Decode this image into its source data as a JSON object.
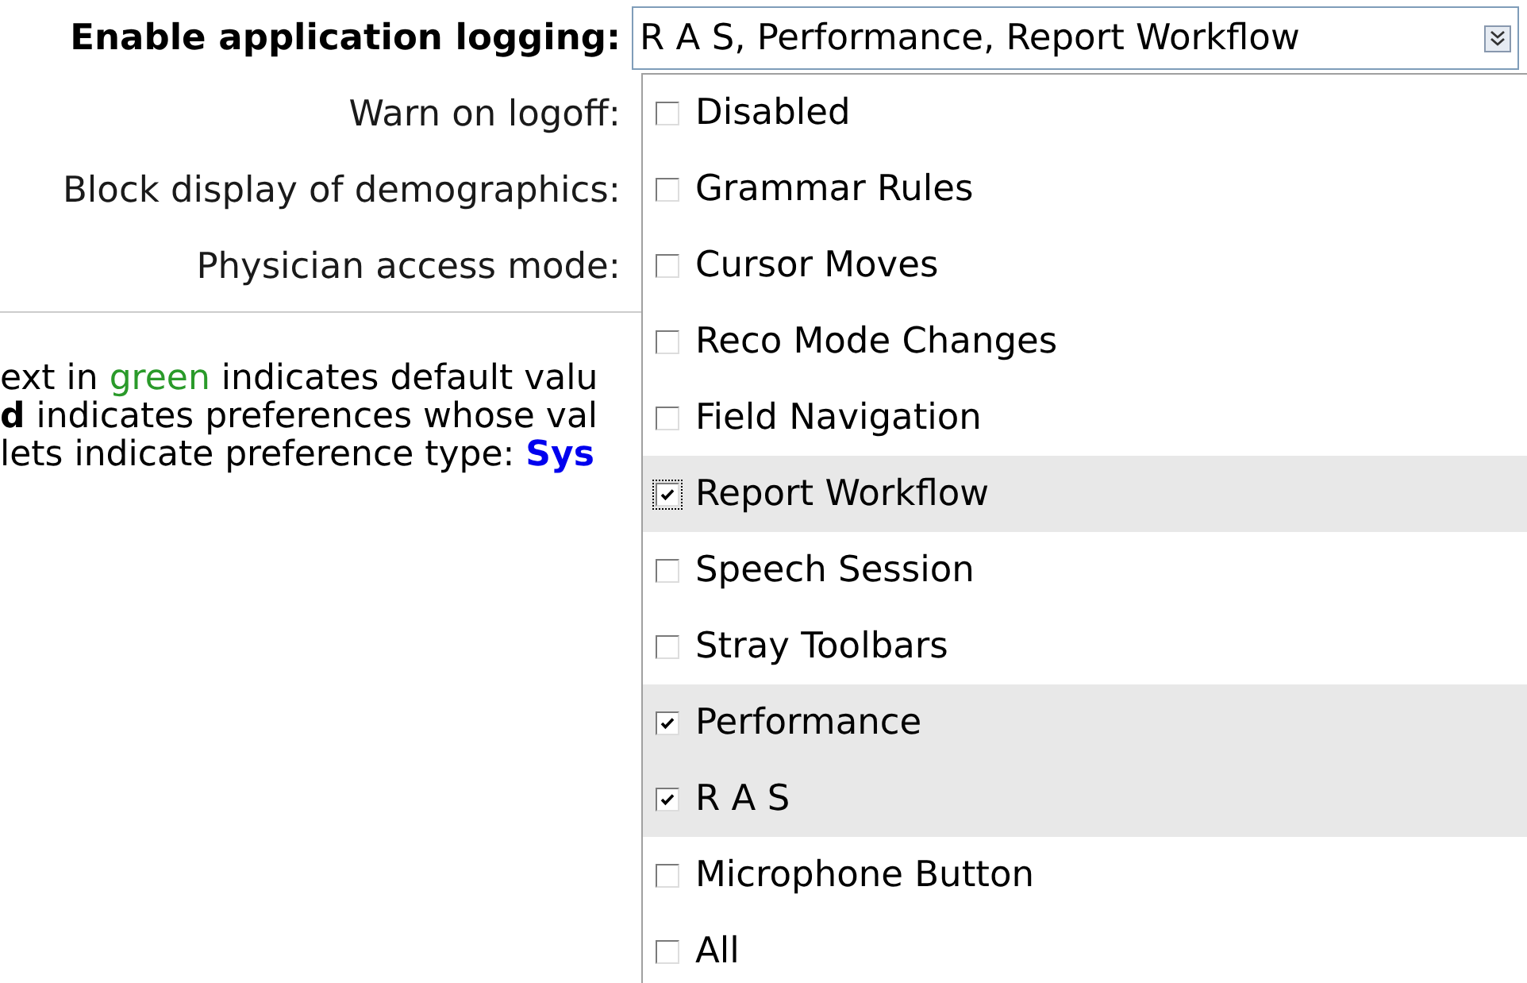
{
  "preferences": [
    {
      "label": "Enable application logging:",
      "kind": "multiselect",
      "value": "R A S, Performance, Report Workflow",
      "expanded": true
    },
    {
      "label": "Warn on logoff:",
      "kind": "plain"
    },
    {
      "label": "Block display of demographics:",
      "kind": "plain"
    },
    {
      "label": "Physician access mode:",
      "kind": "plain"
    }
  ],
  "notes": [
    [
      {
        "text": "ext in ",
        "kind": "plain"
      },
      {
        "text": "green",
        "kind": "green"
      },
      {
        "text": " indicates default valu",
        "kind": "plain"
      }
    ],
    [
      {
        "text": "d",
        "kind": "bold"
      },
      {
        "text": " indicates preferences whose val",
        "kind": "plain"
      }
    ],
    [
      {
        "text": "lets indicate preference type: ",
        "kind": "plain"
      },
      {
        "text": "Sys",
        "kind": "blue"
      }
    ]
  ],
  "options": [
    {
      "label": "Disabled",
      "checked": false,
      "focused": false
    },
    {
      "label": "Grammar Rules",
      "checked": false,
      "focused": false
    },
    {
      "label": "Cursor Moves",
      "checked": false,
      "focused": false
    },
    {
      "label": "Reco Mode Changes",
      "checked": false,
      "focused": false
    },
    {
      "label": "Field Navigation",
      "checked": false,
      "focused": false
    },
    {
      "label": "Report Workflow",
      "checked": true,
      "focused": true
    },
    {
      "label": "Speech Session",
      "checked": false,
      "focused": false
    },
    {
      "label": "Stray Toolbars",
      "checked": false,
      "focused": false
    },
    {
      "label": "Performance",
      "checked": true,
      "focused": false
    },
    {
      "label": "R A S",
      "checked": true,
      "focused": false
    },
    {
      "label": "Microphone Button",
      "checked": false,
      "focused": false
    },
    {
      "label": "All",
      "checked": false,
      "focused": false
    }
  ]
}
